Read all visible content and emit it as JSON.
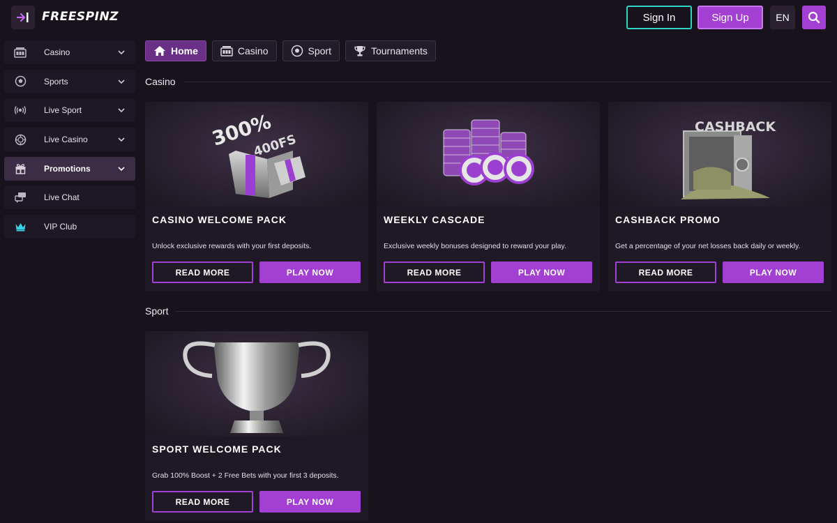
{
  "header": {
    "logo_text": "FREESPINZ",
    "sign_in_label": "Sign In",
    "sign_up_label": "Sign Up",
    "language": "EN"
  },
  "sidebar": {
    "items": [
      {
        "label": "Casino",
        "icon": "slot-machine-icon",
        "has_dropdown": true
      },
      {
        "label": "Sports",
        "icon": "soccer-ball-icon",
        "has_dropdown": true
      },
      {
        "label": "Live Sport",
        "icon": "broadcast-icon",
        "has_dropdown": true
      },
      {
        "label": "Live Casino",
        "icon": "casino-chip-icon",
        "has_dropdown": true
      },
      {
        "label": "Promotions",
        "icon": "gift-icon",
        "has_dropdown": true,
        "active": true
      },
      {
        "label": "Live Chat",
        "icon": "chat-icon",
        "has_dropdown": false
      },
      {
        "label": "VIP Club",
        "icon": "crown-icon",
        "has_dropdown": false
      }
    ]
  },
  "tabs": [
    {
      "label": "Home",
      "icon": "home-icon",
      "active": true
    },
    {
      "label": "Casino",
      "icon": "slot-machine-icon"
    },
    {
      "label": "Sport",
      "icon": "soccer-ball-icon"
    },
    {
      "label": "Tournaments",
      "icon": "trophy-icon"
    }
  ],
  "sections": {
    "casino": {
      "title": "Casino",
      "cards": [
        {
          "title": "CASINO WELCOME PACK",
          "description": "Unlock exclusive rewards with your first deposits.",
          "image_text": [
            "300%",
            "400FS"
          ],
          "read_more": "READ MORE",
          "play_now": "PLAY NOW"
        },
        {
          "title": "WEEKLY CASCADE",
          "description": "Exclusive weekly bonuses designed to reward your play.",
          "read_more": "READ MORE",
          "play_now": "PLAY NOW"
        },
        {
          "title": "CASHBACK PROMO",
          "description": "Get a percentage of your net losses back daily or weekly.",
          "image_text": [
            "CASHBACK"
          ],
          "read_more": "READ MORE",
          "play_now": "PLAY NOW"
        }
      ]
    },
    "sport": {
      "title": "Sport",
      "cards": [
        {
          "title": "SPORT WELCOME PACK",
          "description": "Grab 100% Boost + 2 Free Bets with your first 3 deposits.",
          "read_more": "READ MORE",
          "play_now": "PLAY NOW"
        }
      ]
    }
  },
  "colors": {
    "background": "#17121b",
    "accent": "#a43fd3",
    "sign_in_border": "#2fd6c6",
    "card": "#1f1925"
  }
}
